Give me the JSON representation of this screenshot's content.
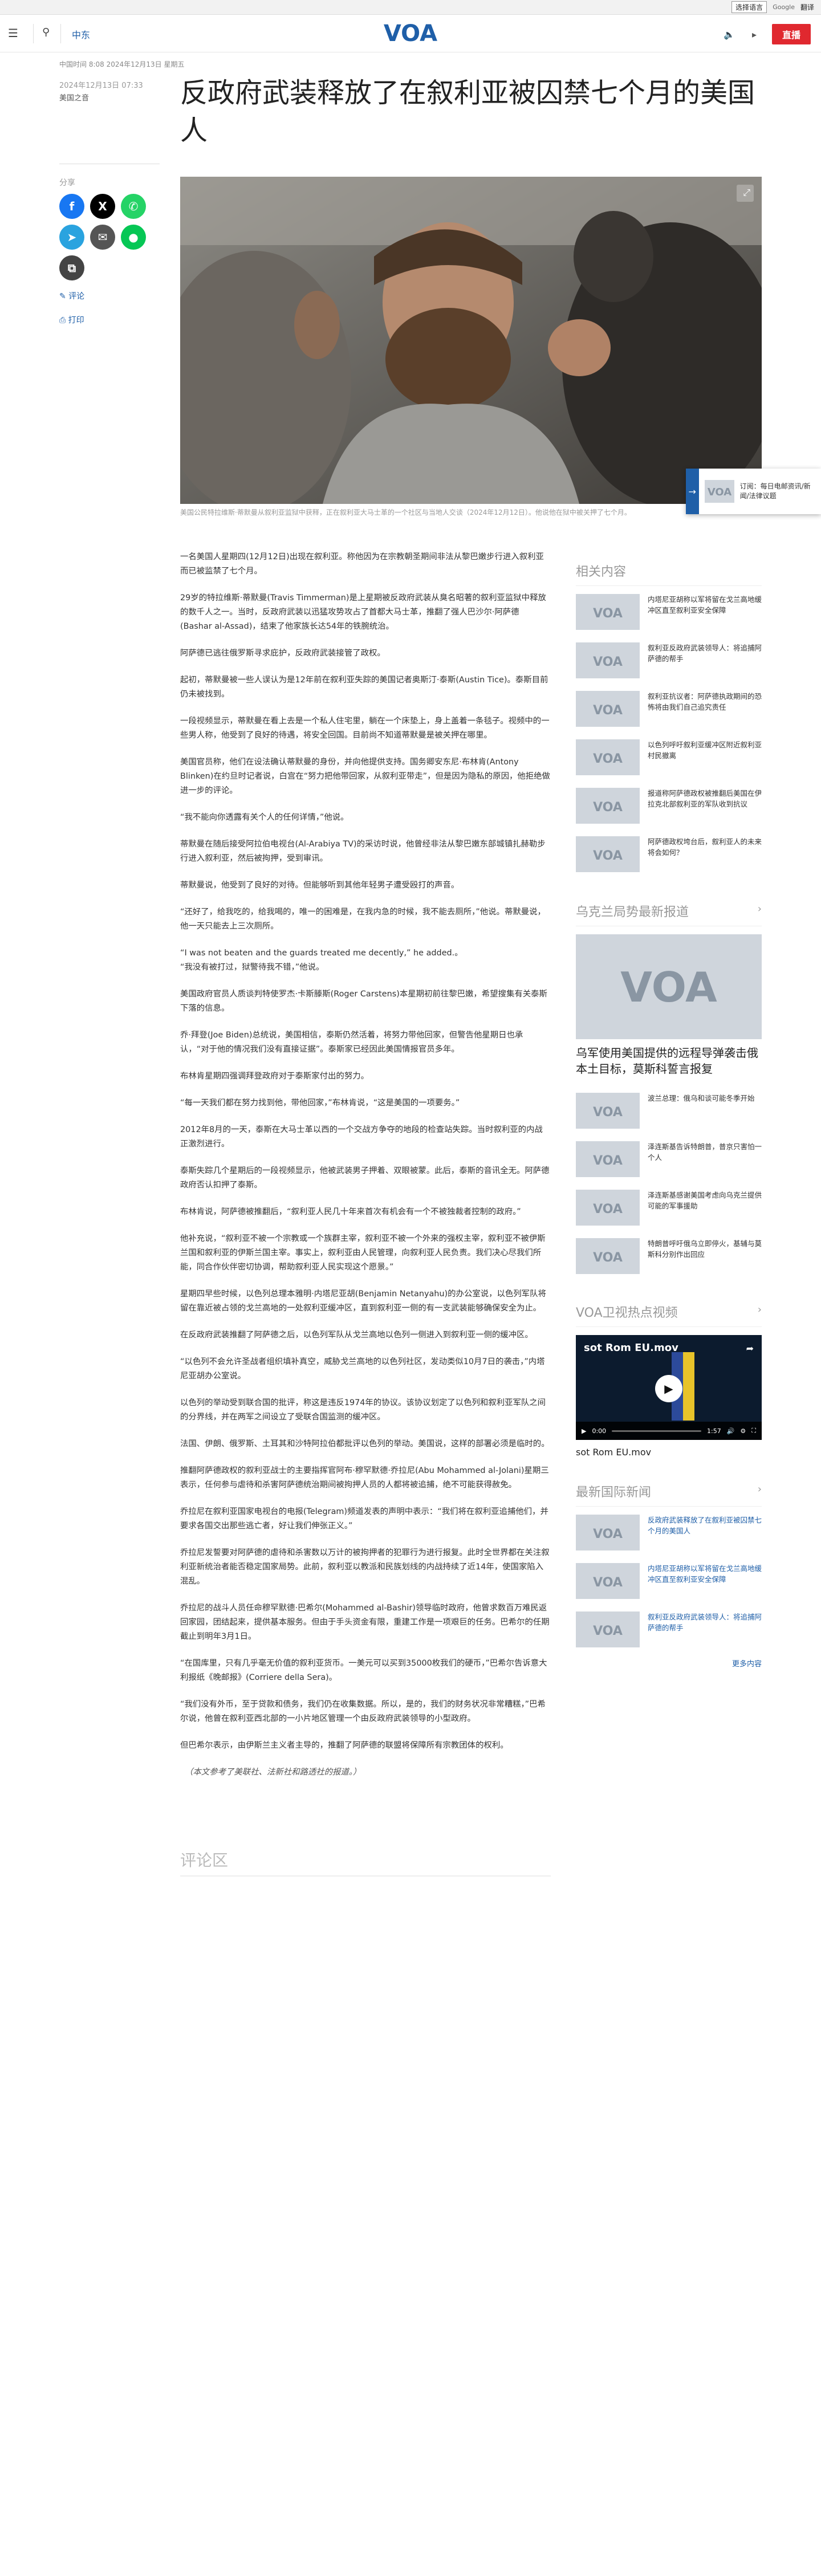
{
  "topbar": {
    "lang_select": "选择语言",
    "powered": "Google",
    "translate": "翻译"
  },
  "header": {
    "section": "中东",
    "live": "直播"
  },
  "article": {
    "crumb": "中国时间 8:08 2024年12月13日 星期五",
    "date": "2024年12月13日 07:33",
    "source": "美国之音",
    "title": "反政府武装释放了在叙利亚被囚禁七个月的美国人",
    "caption": "美国公民特拉维斯·蒂默曼从叙利亚监狱中获释，正在叙利亚大马士革的一个社区与当地人交谈（2024年12月12日）。他说他在狱中被关押了七个月。",
    "paragraphs": [
      "一名美国人星期四(12月12日)出现在叙利亚。称他因为在宗教朝圣期间非法从黎巴嫩步行进入叙利亚而已被监禁了七个月。",
      "29岁的特拉维斯·蒂默曼(Travis Timmerman)是上星期被反政府武装从臭名昭著的叙利亚监狱中释放的数千人之一。当时，反政府武装以迅猛攻势攻占了首都大马士革，推翻了强人巴沙尔·阿萨德(Bashar al-Assad)，结束了他家族长达54年的铁腕统治。",
      "阿萨德已逃往俄罗斯寻求庇护，反政府武装接管了政权。",
      "起初，蒂默曼被一些人误认为是12年前在叙利亚失踪的美国记者奥斯汀·泰斯(Austin Tice)。泰斯目前仍未被找到。",
      "一段视频显示，蒂默曼在看上去是一个私人住宅里，躺在一个床垫上，身上盖着一条毯子。视频中的一些男人称，他受到了良好的待遇，将安全回国。目前尚不知道蒂默曼是被关押在哪里。",
      "美国官员称，他们在设法确认蒂默曼的身份，并向他提供支持。国务卿安东尼·布林肯(Antony Blinken)在约旦时记者说，白宫在“努力把他带回家，从叙利亚带走”，但是因为隐私的原因，他拒绝做进一步的评论。",
      "“我不能向你透露有关个人的任何详情，”他说。",
      "蒂默曼在随后接受阿拉伯电视台(Al-Arabiya TV)的采访时说，他曾经非法从黎巴嫩东部城镇扎赫勒步行进入叙利亚，然后被拘押，受到审讯。",
      "蒂默曼说，他受到了良好的对待。但能够听到其他年轻男子遭受殴打的声音。",
      "“还好了，给我吃的，给我喝的，唯一的困难是，在我内急的时候，我不能去厕所，”他说。蒂默曼说，他一天只能去上三次厕所。",
      "“I was not beaten and the guards treated me decently,” he added.。\n“我没有被打过，狱警待我不错，”他说。",
      "美国政府官员人质谈判特使罗杰·卡斯滕斯(Roger Carstens)本星期初前往黎巴嫩，希望搜集有关泰斯下落的信息。",
      "乔·拜登(Joe Biden)总统说，美国相信，泰斯仍然活着，将努力带他回家，但警告他星期日也承认，“对于他的情况我们没有直接证据”。泰斯家已经因此美国情报官员多年。",
      "布林肯星期四强调拜登政府对于泰斯家付出的努力。",
      "“每一天我们都在努力找到他，带他回家，”布林肯说，“这是美国的一项要务。”",
      "2012年8月的一天，泰斯在大马士革以西的一个交战方争夺的地段的检查站失踪。当时叙利亚的内战正激烈进行。",
      "泰斯失踪几个星期后的一段视频显示，他被武装男子押着、双眼被蒙。此后，泰斯的音讯全无。阿萨德政府否认扣押了泰斯。",
      "布林肯说，阿萨德被推翻后，“叙利亚人民几十年来首次有机会有一个不被独裁者控制的政府。”",
      "他补充说，“叙利亚不被一个宗教或一个族群主宰，叙利亚不被一个外来的强权主宰，叙利亚不被伊斯兰国和叙利亚的伊斯兰国主宰。事实上，叙利亚由人民管理，向叙利亚人民负责。我们决心尽我们所能，同合作伙伴密切协调，帮助叙利亚人民实现这个愿景。”",
      "星期四早些时候，以色列总理本雅明·内塔尼亚胡(Benjamin Netanyahu)的办公室说，以色列军队将留在靠近被占领的戈兰高地的一处叙利亚缓冲区，直到叙利亚一侧的有一支武装能够确保安全为止。",
      "在反政府武装推翻了阿萨德之后，以色列军队从戈兰高地以色列一侧进入到叙利亚一侧的缓冲区。",
      "“以色列不会允许圣战者组织填补真空，威胁戈兰高地的以色列社区，发动类似10月7日的袭击，”内塔尼亚胡办公室说。",
      "以色列的举动受到联合国的批评，称这是违反1974年的协议。该协议划定了以色列和叙利亚军队之间的分界线，并在两军之间设立了受联合国监测的缓冲区。",
      "法国、伊朗、俄罗斯、土耳其和沙特阿拉伯都批评以色列的举动。美国说，这样的部署必须是临时的。",
      "推翻阿萨德政权的叙利亚战士的主要指挥官阿布·穆罕默德·乔拉尼(Abu Mohammed al-Jolani)星期三表示，任何参与虐待和杀害阿萨德统治期间被拘押人员的人都将被追捕，绝不可能获得赦免。",
      "乔拉尼在叙利亚国家电视台的电报(Telegram)频道发表的声明中表示：“我们将在叙利亚追捕他们，并要求各国交出那些逃亡者，好让我们伸张正义。”",
      "乔拉尼发誓要对阿萨德的虐待和杀害数以万计的被拘押者的犯罪行为进行报复。此时全世界都在关注叙利亚新统治者能否稳定国家局势。此前，叙利亚以教派和民族划线的内战持续了近14年，使国家陷入混乱。",
      "乔拉尼的战斗人员任命穆罕默德·巴希尔(Mohammed al-Bashir)领导临时政府，他曾求数百万难民返回家园，团结起来，提供基本服务。但由于手头资金有限，重建工作是一项艰巨的任务。巴希尔的任期截止到明年3月1日。",
      "“在国库里，只有几乎毫无价值的叙利亚货币。一美元可以买到35000枚我们的硬币，”巴希尔告诉意大利报纸《晚邮报》(Corriere della Sera)。",
      "“我们没有外币，至于贷款和债务，我们仍在收集数据。所以，是的，我们的财务状况非常糟糕，”巴希尔说，他曾在叙利亚西北部的一小片地区管理一个由反政府武装领导的小型政府。",
      "但巴希尔表示，由伊斯兰主义者主导的，推翻了阿萨德的联盟将保障所有宗教团体的权利。"
    ],
    "note": "（本文参考了美联社、法新社和路透社的报道。）",
    "share_label": "分享",
    "comment_link": "评论",
    "print_link": "打印",
    "comments_heading": "评论区"
  },
  "sidebar": {
    "related_title": "相关内容",
    "related": [
      "内塔尼亚胡称以军将留在戈兰高地缓冲区直至叙利亚安全保障",
      "叙利亚反政府武装领导人：将追捕阿萨德的帮手",
      "叙利亚抗议者：阿萨德执政期间的恐怖将由我们自己追究责任",
      "以色列呼吁叙利亚缓冲区附近叙利亚村民撤离",
      "报道称阿萨德政权被推翻后美国在伊拉克北部叙利亚的军队收到抗议",
      "阿萨德政权垮台后，叙利亚人的未来将会如何？"
    ],
    "ukraine_title": "乌克兰局势最新报道",
    "ukraine_feature": "乌军使用美国提供的远程导弹袭击俄本土目标，莫斯科誓言报复",
    "ukraine": [
      "波兰总理：俄乌和谈可能冬季开始",
      "泽连斯基告诉特朗普，普京只害怕一个人",
      "泽连斯基感谢美国考虑向乌克兰提供可能的军事援助",
      "特朗普呼吁俄乌立即停火，基辅与莫斯科分别作出回应"
    ],
    "video_title": "VOA卫视热点视频",
    "video_label": "sot Rom EU.mov",
    "video_time": "0:00",
    "video_duration": "1:57",
    "video_caption": "sot Rom EU.mov",
    "latest_title": "最新国际新闻",
    "latest": [
      "反政府武装释放了在叙利亚被囚禁七个月的美国人",
      "内塔尼亚胡称以军将留在戈兰高地缓冲区直至叙利亚安全保障",
      "叙利亚反政府武装领导人：将追捕阿萨德的帮手"
    ],
    "more": "更多内容"
  },
  "popup": {
    "text": "订阅：每日电邮资讯/新闻/法律议题"
  },
  "colors": {
    "brand": "#1f5fa8",
    "live": "#e0282f"
  }
}
